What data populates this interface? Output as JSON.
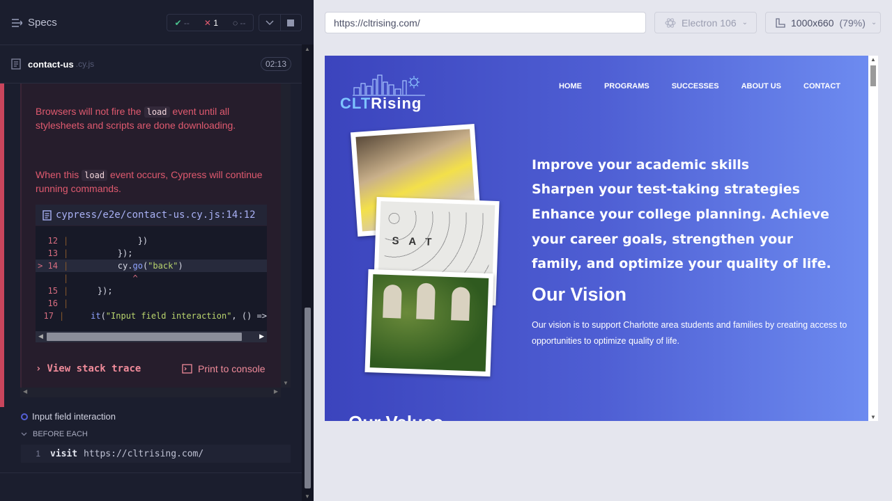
{
  "left": {
    "specs_label": "Specs",
    "stats": {
      "passed": "--",
      "failed": "1",
      "pending": "--"
    },
    "file": {
      "name": "contact-us",
      "ext": ".cy.js",
      "time": "02:13"
    },
    "error": {
      "p1_a": "Browsers will not fire the",
      "p1_code": "load",
      "p1_b": "event until all stylesheets and scripts are done downloading.",
      "p2_a": "When this",
      "p2_code": "load",
      "p2_b": "event occurs, Cypress will continue running commands.",
      "code_path": "cypress/e2e/contact-us.cy.js:14:12",
      "lines": [
        {
          "n": "12",
          "text": "            })"
        },
        {
          "n": "13",
          "text": "        });"
        },
        {
          "n": "14",
          "text": "        cy.go(\"back\")"
        },
        {
          "n": "",
          "text": "           ^"
        },
        {
          "n": "15",
          "text": "    });"
        },
        {
          "n": "16",
          "text": ""
        },
        {
          "n": "17",
          "text": "    it(\"Input field interaction\", () =>"
        }
      ],
      "view_stack": "View stack trace",
      "print_console": "Print to console"
    },
    "test_title": "Input field interaction",
    "before_each": "BEFORE EACH",
    "command": {
      "num": "1",
      "name": "visit",
      "arg": "https://cltrising.com/"
    }
  },
  "right": {
    "url": "https://cltrising.com/",
    "browser": "Electron 106",
    "viewport": "1000x660",
    "zoom": "(79%)",
    "site": {
      "logo_clt": "CLT",
      "logo_rising": "Rising",
      "nav": [
        "HOME",
        "PROGRAMS",
        "SUCCESSES",
        "ABOUT US",
        "CONTACT"
      ],
      "headlines": [
        "Improve your academic skills",
        "Sharpen your test-taking strategies",
        "Enhance your college planning. Achieve",
        "your career goals, strengthen your",
        "family, and optimize your quality of life."
      ],
      "vision_title": "Our Vision",
      "vision_text": "Our vision is to support Charlotte area students and families by creating access to opportunities to optimize quality of life.",
      "values_title": "Our Values"
    }
  },
  "colors": {
    "error": "#e05a6f",
    "accent": "#a9b1f5",
    "hero_start": "#3b44bd",
    "hero_end": "#6d8bf0"
  }
}
